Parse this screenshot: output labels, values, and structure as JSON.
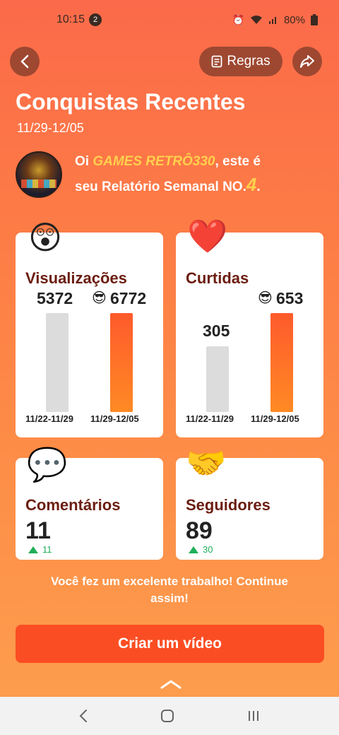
{
  "status_bar": {
    "time": "10:15",
    "notification_count": "2",
    "battery": "80%"
  },
  "header": {
    "rules_label": "Regras",
    "title": "Conquistas Recentes",
    "date_range": "11/29-12/05"
  },
  "greeting": {
    "prefix": "Oi ",
    "username": "GAMES RETRÔ330",
    "suffix": ", este é",
    "line2": "seu Relatório Semanal NO.",
    "report_number": "4",
    "end": "."
  },
  "stats": {
    "views": {
      "label": "Visualizações",
      "prev_value": "5372",
      "curr_value": "6772",
      "prev_period": "11/22-11/29",
      "curr_period": "11/29-12/05"
    },
    "likes": {
      "label": "Curtidas",
      "prev_value": "305",
      "curr_value": "653",
      "prev_period": "11/22-11/29",
      "curr_period": "11/29-12/05"
    },
    "comments": {
      "label": "Comentários",
      "value": "11",
      "delta": "11"
    },
    "followers": {
      "label": "Seguidores",
      "value": "89",
      "delta": "30"
    }
  },
  "encouragement_line1": "Você fez um excelente trabalho! Continue",
  "encouragement_line2": "assim!",
  "create_video_label": "Criar um vídeo",
  "colors": {
    "accent": "#fb4d23",
    "username": "#ffd04d",
    "label": "#6b1d10",
    "positive": "#1faf5a"
  }
}
